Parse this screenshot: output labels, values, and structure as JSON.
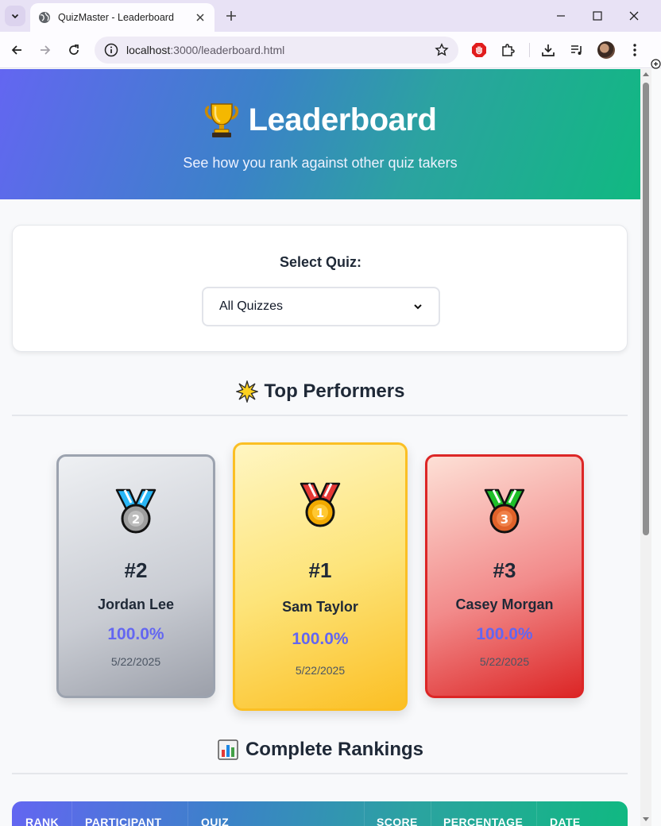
{
  "browser": {
    "tab_title": "QuizMaster - Leaderboard",
    "url_host": "localhost",
    "url_rest": ":3000/leaderboard.html"
  },
  "hero": {
    "title": "Leaderboard",
    "subtitle": "See how you rank against other quiz takers"
  },
  "quiz_select": {
    "label": "Select Quiz:",
    "value": "All Quizzes"
  },
  "top_performers": {
    "title": "Top Performers",
    "cards": [
      {
        "rank": "#2",
        "name": "Jordan Lee",
        "percentage": "100.0%",
        "date": "5/22/2025",
        "medal": "second-place-medal-icon"
      },
      {
        "rank": "#1",
        "name": "Sam Taylor",
        "percentage": "100.0%",
        "date": "5/22/2025",
        "medal": "first-place-medal-icon"
      },
      {
        "rank": "#3",
        "name": "Casey Morgan",
        "percentage": "100.0%",
        "date": "5/22/2025",
        "medal": "third-place-medal-icon"
      }
    ]
  },
  "rankings": {
    "title": "Complete Rankings",
    "columns": [
      "RANK",
      "PARTICIPANT",
      "QUIZ",
      "SCORE",
      "PERCENTAGE",
      "DATE"
    ]
  },
  "colors": {
    "accent": "#6366f1",
    "gradient_start": "#6366f1",
    "gradient_end": "#10b981",
    "gold": "#fbbf24",
    "silver": "#9ca3af",
    "bronze": "#dc2626"
  }
}
